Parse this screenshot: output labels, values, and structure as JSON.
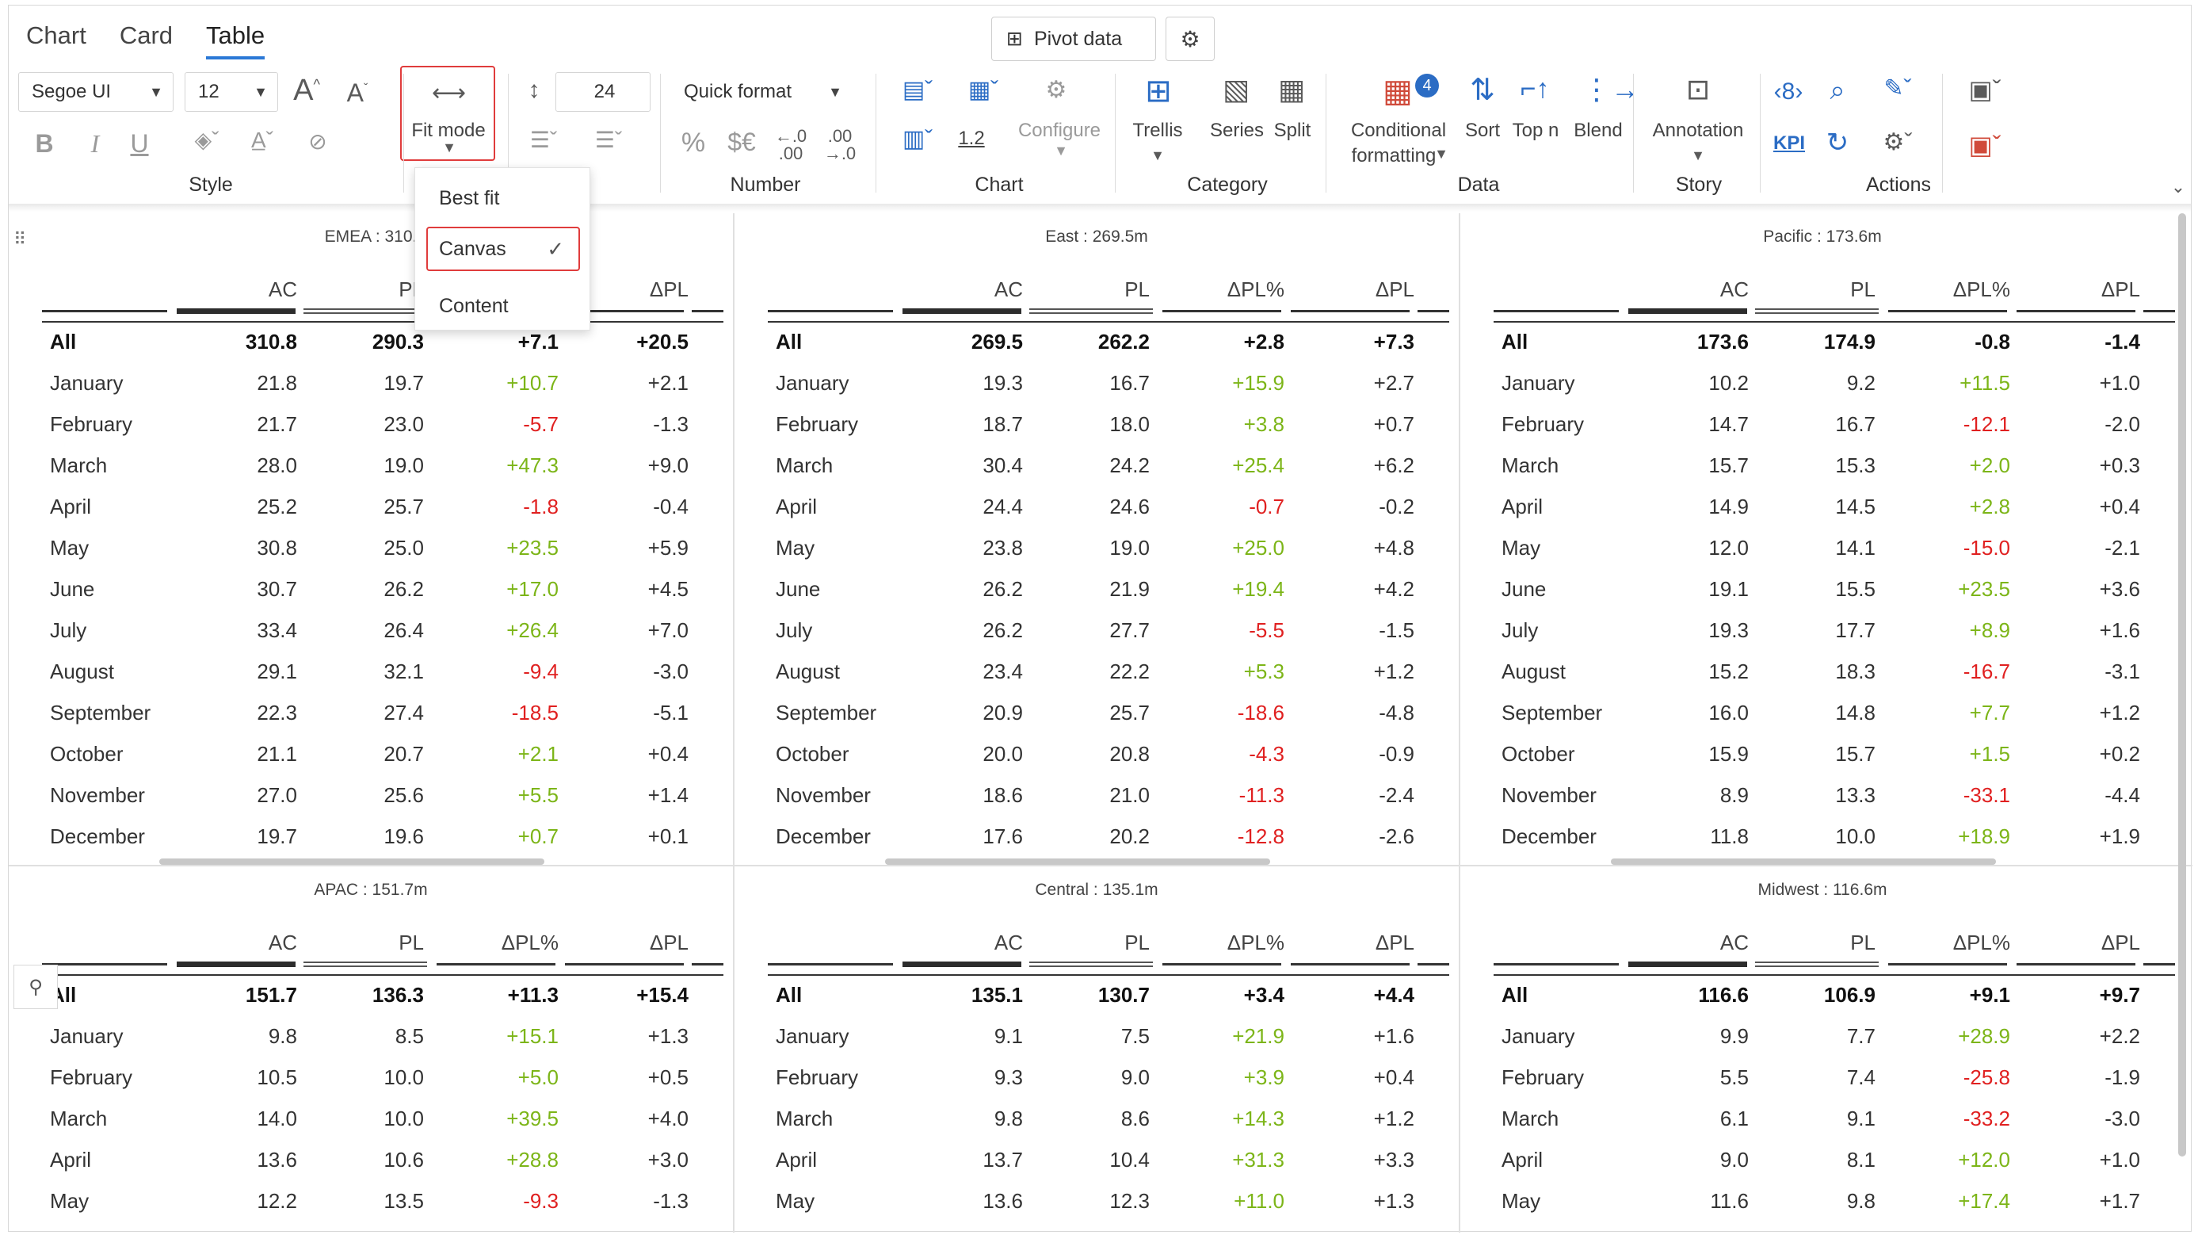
{
  "tabs": [
    {
      "label": "Chart"
    },
    {
      "label": "Card"
    },
    {
      "label": "Table"
    }
  ],
  "toolbar": {
    "pivot_label": "Pivot data",
    "font_name": "Segoe UI",
    "font_size": "12",
    "row_height": "24",
    "quick_format": "Quick format",
    "fit_mode_label": "Fit mode",
    "configure_label": "Configure",
    "decimal_label": "1.2",
    "trellis_label": "Trellis",
    "series_label": "Series",
    "split_label": "Split",
    "cond_label_1": "Conditional",
    "cond_label_2": "formatting",
    "cond_badge": "4",
    "sort_label": "Sort",
    "topn_label": "Top n",
    "blend_label": "Blend",
    "annotation_label": "Annotation",
    "kpi_label": "KPI",
    "groups": {
      "style": "Style",
      "number": "Number",
      "chart": "Chart",
      "category": "Category",
      "data": "Data",
      "story": "Story",
      "actions": "Actions"
    }
  },
  "fit_menu": {
    "items": [
      {
        "label": "Best fit"
      },
      {
        "label": "Canvas"
      },
      {
        "label": "Content"
      }
    ]
  },
  "columns": [
    "AC",
    "PL",
    "ΔPL%",
    "ΔPL"
  ],
  "panels": [
    {
      "title": "EMEA : 310.",
      "total": [
        "All",
        "310.8",
        "290.3",
        "+7.1",
        "+20.5"
      ],
      "rows": [
        [
          "January",
          "21.8",
          "19.7",
          "+10.7",
          "+2.1"
        ],
        [
          "February",
          "21.7",
          "23.0",
          "-5.7",
          "-1.3"
        ],
        [
          "March",
          "28.0",
          "19.0",
          "+47.3",
          "+9.0"
        ],
        [
          "April",
          "25.2",
          "25.7",
          "-1.8",
          "-0.4"
        ],
        [
          "May",
          "30.8",
          "25.0",
          "+23.5",
          "+5.9"
        ],
        [
          "June",
          "30.7",
          "26.2",
          "+17.0",
          "+4.5"
        ],
        [
          "July",
          "33.4",
          "26.4",
          "+26.4",
          "+7.0"
        ],
        [
          "August",
          "29.1",
          "32.1",
          "-9.4",
          "-3.0"
        ],
        [
          "September",
          "22.3",
          "27.4",
          "-18.5",
          "-5.1"
        ],
        [
          "October",
          "21.1",
          "20.7",
          "+2.1",
          "+0.4"
        ],
        [
          "November",
          "27.0",
          "25.6",
          "+5.5",
          "+1.4"
        ],
        [
          "December",
          "19.7",
          "19.6",
          "+0.7",
          "+0.1"
        ]
      ]
    },
    {
      "title": "East : 269.5m",
      "total": [
        "All",
        "269.5",
        "262.2",
        "+2.8",
        "+7.3"
      ],
      "rows": [
        [
          "January",
          "19.3",
          "16.7",
          "+15.9",
          "+2.7"
        ],
        [
          "February",
          "18.7",
          "18.0",
          "+3.8",
          "+0.7"
        ],
        [
          "March",
          "30.4",
          "24.2",
          "+25.4",
          "+6.2"
        ],
        [
          "April",
          "24.4",
          "24.6",
          "-0.7",
          "-0.2"
        ],
        [
          "May",
          "23.8",
          "19.0",
          "+25.0",
          "+4.8"
        ],
        [
          "June",
          "26.2",
          "21.9",
          "+19.4",
          "+4.2"
        ],
        [
          "July",
          "26.2",
          "27.7",
          "-5.5",
          "-1.5"
        ],
        [
          "August",
          "23.4",
          "22.2",
          "+5.3",
          "+1.2"
        ],
        [
          "September",
          "20.9",
          "25.7",
          "-18.6",
          "-4.8"
        ],
        [
          "October",
          "20.0",
          "20.8",
          "-4.3",
          "-0.9"
        ],
        [
          "November",
          "18.6",
          "21.0",
          "-11.3",
          "-2.4"
        ],
        [
          "December",
          "17.6",
          "20.2",
          "-12.8",
          "-2.6"
        ]
      ]
    },
    {
      "title": "Pacific : 173.6m",
      "total": [
        "All",
        "173.6",
        "174.9",
        "-0.8",
        "-1.4"
      ],
      "rows": [
        [
          "January",
          "10.2",
          "9.2",
          "+11.5",
          "+1.0"
        ],
        [
          "February",
          "14.7",
          "16.7",
          "-12.1",
          "-2.0"
        ],
        [
          "March",
          "15.7",
          "15.3",
          "+2.0",
          "+0.3"
        ],
        [
          "April",
          "14.9",
          "14.5",
          "+2.8",
          "+0.4"
        ],
        [
          "May",
          "12.0",
          "14.1",
          "-15.0",
          "-2.1"
        ],
        [
          "June",
          "19.1",
          "15.5",
          "+23.5",
          "+3.6"
        ],
        [
          "July",
          "19.3",
          "17.7",
          "+8.9",
          "+1.6"
        ],
        [
          "August",
          "15.2",
          "18.3",
          "-16.7",
          "-3.1"
        ],
        [
          "September",
          "16.0",
          "14.8",
          "+7.7",
          "+1.2"
        ],
        [
          "October",
          "15.9",
          "15.7",
          "+1.5",
          "+0.2"
        ],
        [
          "November",
          "8.9",
          "13.3",
          "-33.1",
          "-4.4"
        ],
        [
          "December",
          "11.8",
          "10.0",
          "+18.9",
          "+1.9"
        ]
      ]
    },
    {
      "title": "APAC : 151.7m",
      "total": [
        "All",
        "151.7",
        "136.3",
        "+11.3",
        "+15.4"
      ],
      "rows": [
        [
          "January",
          "9.8",
          "8.5",
          "+15.1",
          "+1.3"
        ],
        [
          "February",
          "10.5",
          "10.0",
          "+5.0",
          "+0.5"
        ],
        [
          "March",
          "14.0",
          "10.0",
          "+39.5",
          "+4.0"
        ],
        [
          "April",
          "13.6",
          "10.6",
          "+28.8",
          "+3.0"
        ],
        [
          "May",
          "12.2",
          "13.5",
          "-9.3",
          "-1.3"
        ]
      ]
    },
    {
      "title": "Central : 135.1m",
      "total": [
        "All",
        "135.1",
        "130.7",
        "+3.4",
        "+4.4"
      ],
      "rows": [
        [
          "January",
          "9.1",
          "7.5",
          "+21.9",
          "+1.6"
        ],
        [
          "February",
          "9.3",
          "9.0",
          "+3.9",
          "+0.4"
        ],
        [
          "March",
          "9.8",
          "8.6",
          "+14.3",
          "+1.2"
        ],
        [
          "April",
          "13.7",
          "10.4",
          "+31.3",
          "+3.3"
        ],
        [
          "May",
          "13.6",
          "12.3",
          "+11.0",
          "+1.3"
        ]
      ]
    },
    {
      "title": "Midwest : 116.6m",
      "total": [
        "All",
        "116.6",
        "106.9",
        "+9.1",
        "+9.7"
      ],
      "rows": [
        [
          "January",
          "9.9",
          "7.7",
          "+28.9",
          "+2.2"
        ],
        [
          "February",
          "5.5",
          "7.4",
          "-25.8",
          "-1.9"
        ],
        [
          "March",
          "6.1",
          "9.1",
          "-33.2",
          "-3.0"
        ],
        [
          "April",
          "9.0",
          "8.1",
          "+12.0",
          "+1.0"
        ],
        [
          "May",
          "11.6",
          "9.8",
          "+17.4",
          "+1.7"
        ]
      ]
    }
  ],
  "colors": {
    "positive": "#7cb518",
    "negative": "#e02020",
    "accent": "#2b78d6",
    "highlight": "#e03c3c"
  }
}
